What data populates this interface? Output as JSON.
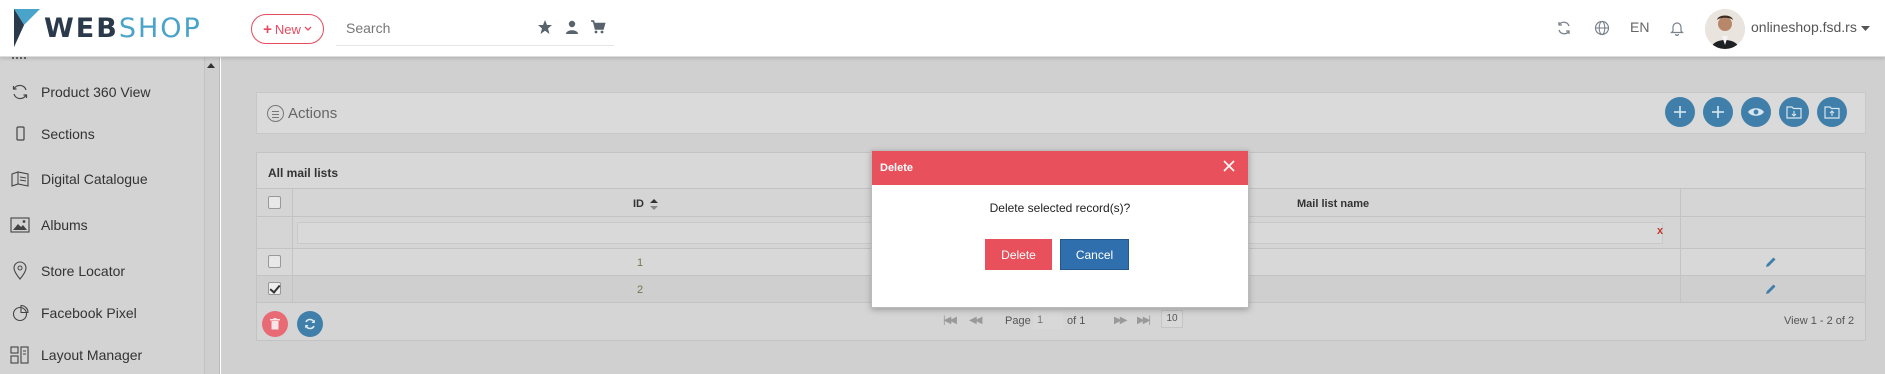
{
  "header": {
    "logo_web": "WEB",
    "logo_shop": "SHOP",
    "new_button": "New",
    "search_placeholder": "Search",
    "language": "EN",
    "account": "onlineshop.fsd.rs"
  },
  "sidebar": {
    "items": [
      {
        "label": "Product 360 View",
        "icon": "rotate-360-icon"
      },
      {
        "label": "Sections",
        "icon": "mobile-icon"
      },
      {
        "label": "Digital Catalogue",
        "icon": "catalogue-icon"
      },
      {
        "label": "Albums",
        "icon": "image-icon"
      },
      {
        "label": "Store Locator",
        "icon": "map-pin-icon"
      },
      {
        "label": "Facebook Pixel",
        "icon": "pie-chart-icon"
      },
      {
        "label": "Layout Manager",
        "icon": "layout-icon"
      }
    ]
  },
  "actions": {
    "title": "Actions",
    "buttons": [
      "add-icon",
      "add-icon",
      "view-icon",
      "folder-import-icon",
      "folder-export-icon"
    ]
  },
  "grid": {
    "caption": "All mail lists",
    "columns": {
      "id": "ID",
      "name": "Mail list name"
    },
    "filter_clear": "x",
    "rows": [
      {
        "id": "1",
        "checked": false
      },
      {
        "id": "2",
        "checked": true
      }
    ]
  },
  "pager": {
    "page_label": "Page",
    "page_value": "1",
    "of_label": "of 1",
    "page_size": "10",
    "view_text": "View 1 - 2 of 2"
  },
  "modal": {
    "title": "Delete",
    "message": "Delete selected record(s)?",
    "confirm": "Delete",
    "cancel": "Cancel"
  },
  "colors": {
    "accent_red": "#e8505c",
    "accent_blue": "#2f6fad",
    "round_button": "#3f7faa",
    "logo_blue": "#4aa3c9"
  }
}
